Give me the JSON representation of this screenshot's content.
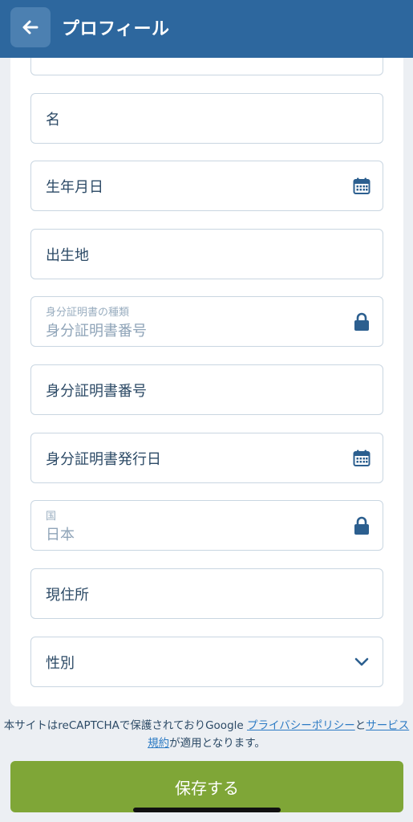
{
  "header": {
    "title": "プロフィール",
    "back_icon": "arrow-left-icon",
    "color": "#2D679E"
  },
  "form": {
    "fields": [
      {
        "label": ""
      },
      {
        "label": "名"
      },
      {
        "label": "生年月日",
        "icon": "calendar-icon"
      },
      {
        "label": "出生地"
      },
      {
        "small_label": "身分証明書の種類",
        "value": "身分証明書番号",
        "icon": "lock-icon",
        "locked": true
      },
      {
        "label": "身分証明書番号"
      },
      {
        "label": "身分証明書発行日",
        "icon": "calendar-icon"
      },
      {
        "small_label": "国",
        "value": "日本",
        "icon": "lock-icon",
        "locked": true
      },
      {
        "label": "現住所"
      },
      {
        "label": "性別",
        "icon": "chevron-down-icon"
      }
    ]
  },
  "footer": {
    "text_pre": "本サイトはreCAPTCHAで保護されておりGoogle ",
    "privacy_link": "プライバシーポリシー",
    "and": "と",
    "terms_link": "サービス規約",
    "text_post": "が適用となります。"
  },
  "save_button": {
    "label": "保存する",
    "color": "#7FA637"
  }
}
